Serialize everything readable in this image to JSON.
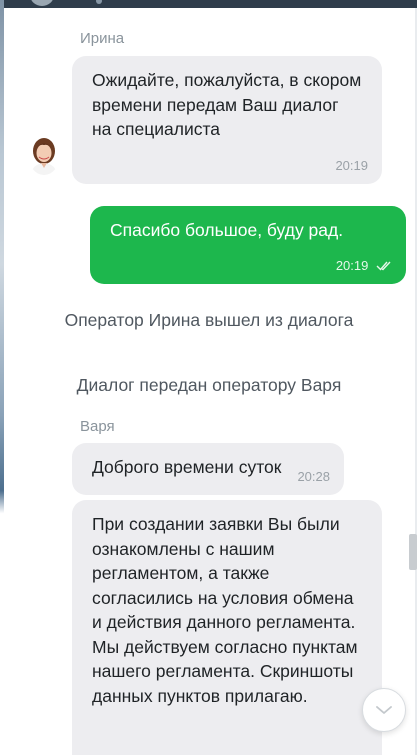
{
  "messages": {
    "m1": {
      "sender": "Ирина",
      "text": "Ожидайте, пожалуйста, в скором времени передам Ваш диалог на специалиста",
      "time": "20:19"
    },
    "m2": {
      "text": "Спасибо большое, буду рад.",
      "time": "20:19"
    },
    "sys1": "Оператор Ирина вышел из диалога",
    "sys2": "Диалог передан оператору Варя",
    "m3": {
      "sender": "Варя",
      "text": "Доброго времени суток",
      "time": "20:28"
    },
    "m4": {
      "text": "При создании заявки Вы были ознакомлены с нашим регламентом, а также согласились на условия обмена и действия данного регламента. Мы действуем согласно пунктам нашего регламента. Скриншоты данных пунктов прилагаю."
    }
  },
  "icons": {
    "scroll_down": "chevron-down-icon",
    "read_receipt": "double-check-icon"
  },
  "colors": {
    "outgoing_bubble": "#1db74d",
    "incoming_bubble": "#ededf0",
    "header": "#2f3d4b"
  }
}
